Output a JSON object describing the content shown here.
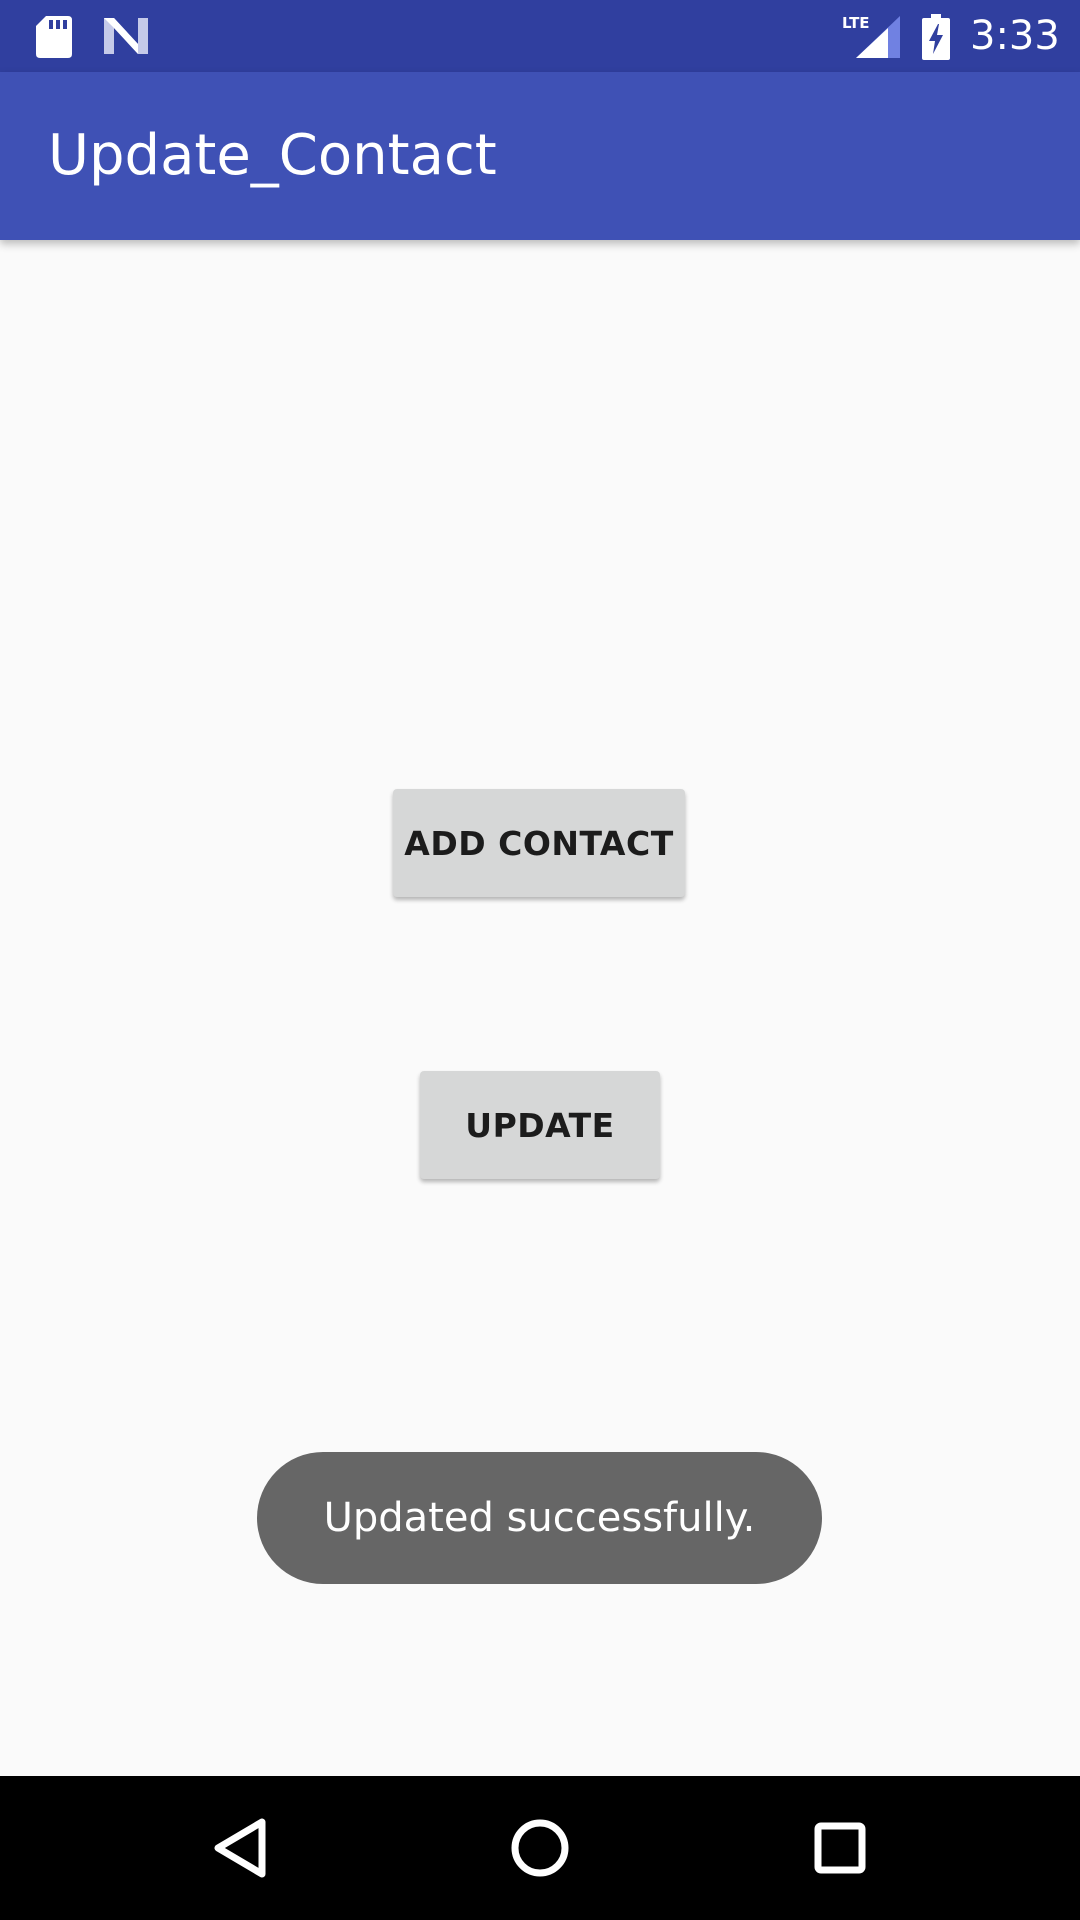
{
  "status_bar": {
    "time": "3:33",
    "network_label": "LTE",
    "icons": [
      "sd-card-icon",
      "n-logo-icon",
      "lte-signal-icon",
      "battery-charging-icon"
    ]
  },
  "app_bar": {
    "title": "Update_Contact",
    "color": "#3f51b5",
    "status_color": "#303f9f"
  },
  "main": {
    "add_contact_label": "ADD CONTACT",
    "update_label": "UPDATE",
    "button_color": "#d6d7d7"
  },
  "toast": {
    "message": "Updated successfully.",
    "color": "#666666"
  },
  "nav_bar": {
    "icons": [
      "back-icon",
      "home-icon",
      "recents-icon"
    ]
  }
}
